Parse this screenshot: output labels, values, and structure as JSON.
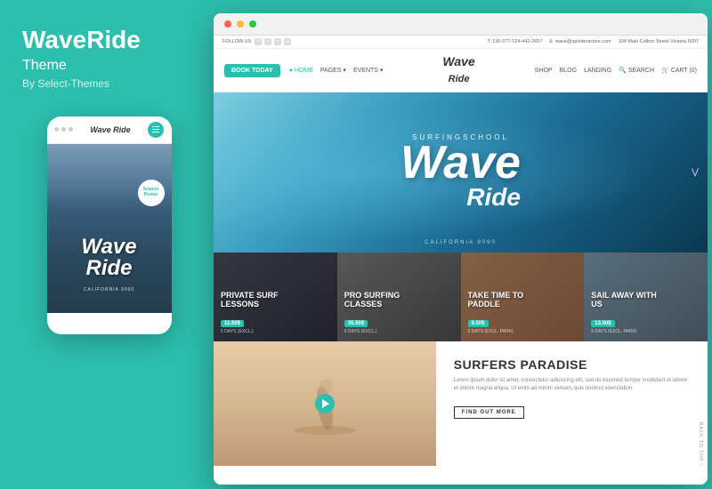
{
  "left_panel": {
    "brand_name": "WaveRide",
    "brand_label": "Theme",
    "brand_by": "By Select-Themes"
  },
  "mobile_mockup": {
    "logo": "Wave Ride",
    "badge_text": "Season\nPromo",
    "wave_script": "Wave",
    "wave_ride": "Ride",
    "sub_text": "CALIFORNIA 9090"
  },
  "browser": {
    "topbar": {
      "follow_us": "FOLLOW US",
      "phone": "T: 136-077-124-442-2657",
      "email": "E: wave@splinteractive.com",
      "address": "104 Main Collins Street Victoria 5007"
    },
    "nav": {
      "book_today": "BOOK TODAY",
      "links": [
        "HOME",
        "PAGES",
        "EVENTS"
      ],
      "logo": "Wave Ride",
      "right_items": [
        "SHOP",
        "BLOG",
        "LANDING",
        "SEARCH",
        "CART (0)"
      ],
      "cart_count": "0"
    },
    "hero": {
      "small_text": "SURFINGSCHOOL",
      "wave_large": "Wave",
      "ride_text": "Ride",
      "sub_text": "CALIFORNIA 9090"
    },
    "promo_cards": [
      {
        "title": "PRIVATE SURF LESSONS",
        "price": "11.50$",
        "meta": "5 DAYS (EXCL.)"
      },
      {
        "title": "PRO SURFING CLASSES",
        "price": "35.50$",
        "meta": "5 DAYS (EXCL.)"
      },
      {
        "title": "TAKE TIME TO PADDLE",
        "price": "9.50$",
        "meta": "5 DAYS (EXCL. PARK)"
      },
      {
        "title": "SAIL AWAY WITH US",
        "price": "13.50$",
        "meta": "5 DAYS (EXCL. PARK)"
      }
    ],
    "bottom": {
      "section_title": "SURFERS PARADISE",
      "body_text": "Lorem ipsum dolor sit amet, consectetur adipiscing elit, sed do eiusmod tempor incididunt ut labore et dolore magna aliqua. Ut enim ad minim veniam, quis nostrud exercitation.",
      "button_label": "FIND OUT MORE"
    }
  },
  "colors": {
    "primary": "#2dbfad",
    "dark": "#333333",
    "white": "#ffffff",
    "light_gray": "#f1f1f1"
  }
}
